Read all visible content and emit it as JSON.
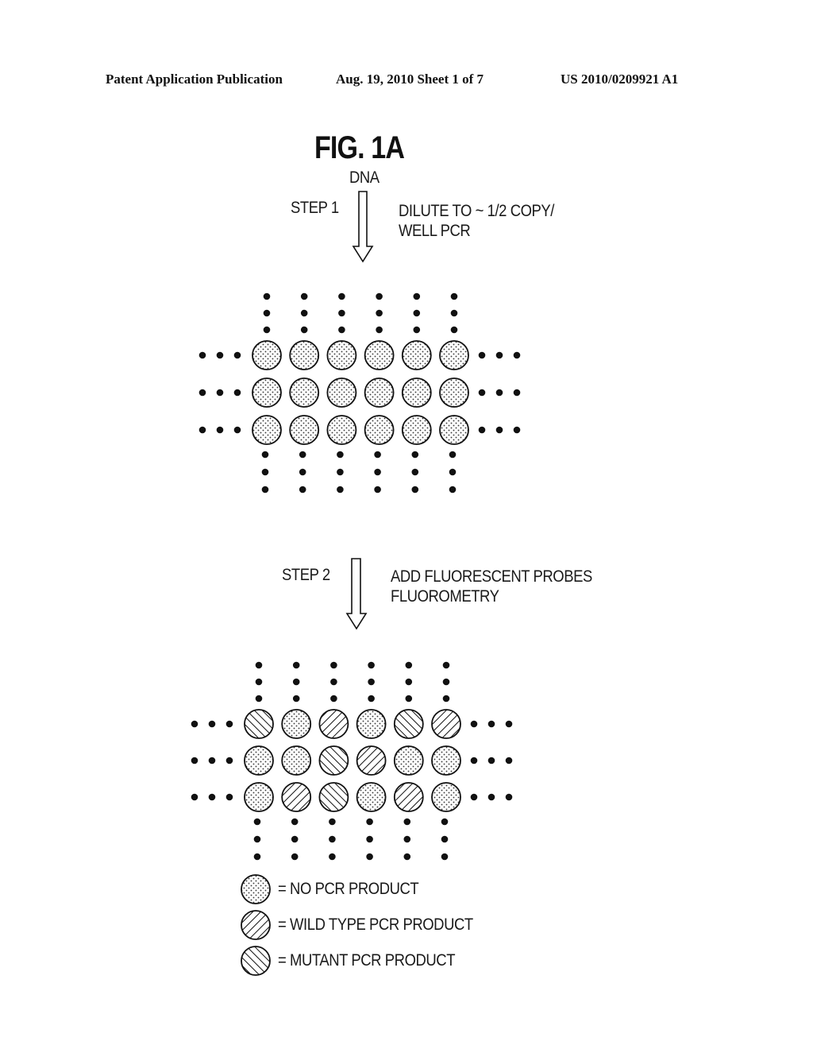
{
  "header": {
    "publication": "Patent Application Publication",
    "date_sheet": "Aug. 19, 2010  Sheet 1 of 7",
    "patent_number": "US 2010/0209921 A1"
  },
  "figure": {
    "title": "FIG. 1A",
    "input_label": "DNA",
    "step1": {
      "label": "STEP 1",
      "description_line1": "DILUTE TO ~ 1/2 COPY/",
      "description_line2": "WELL PCR"
    },
    "step2": {
      "label": "STEP 2",
      "description_line1": "ADD FLUORESCENT PROBES",
      "description_line2": "FLUOROMETRY"
    },
    "grid_before": [
      [
        "none",
        "none",
        "none",
        "none",
        "none",
        "none"
      ],
      [
        "none",
        "none",
        "none",
        "none",
        "none",
        "none"
      ],
      [
        "none",
        "none",
        "none",
        "none",
        "none",
        "none"
      ]
    ],
    "grid_after": [
      [
        "mutant",
        "none",
        "wild",
        "none",
        "mutant",
        "wild"
      ],
      [
        "none",
        "none",
        "mutant",
        "wild",
        "none",
        "none"
      ],
      [
        "none",
        "wild",
        "mutant",
        "none",
        "wild",
        "none"
      ]
    ],
    "legend": [
      {
        "pattern": "none",
        "label": "= NO PCR PRODUCT"
      },
      {
        "pattern": "wild",
        "label": "= WILD TYPE PCR PRODUCT"
      },
      {
        "pattern": "mutant",
        "label": "= MUTANT PCR PRODUCT"
      }
    ]
  }
}
